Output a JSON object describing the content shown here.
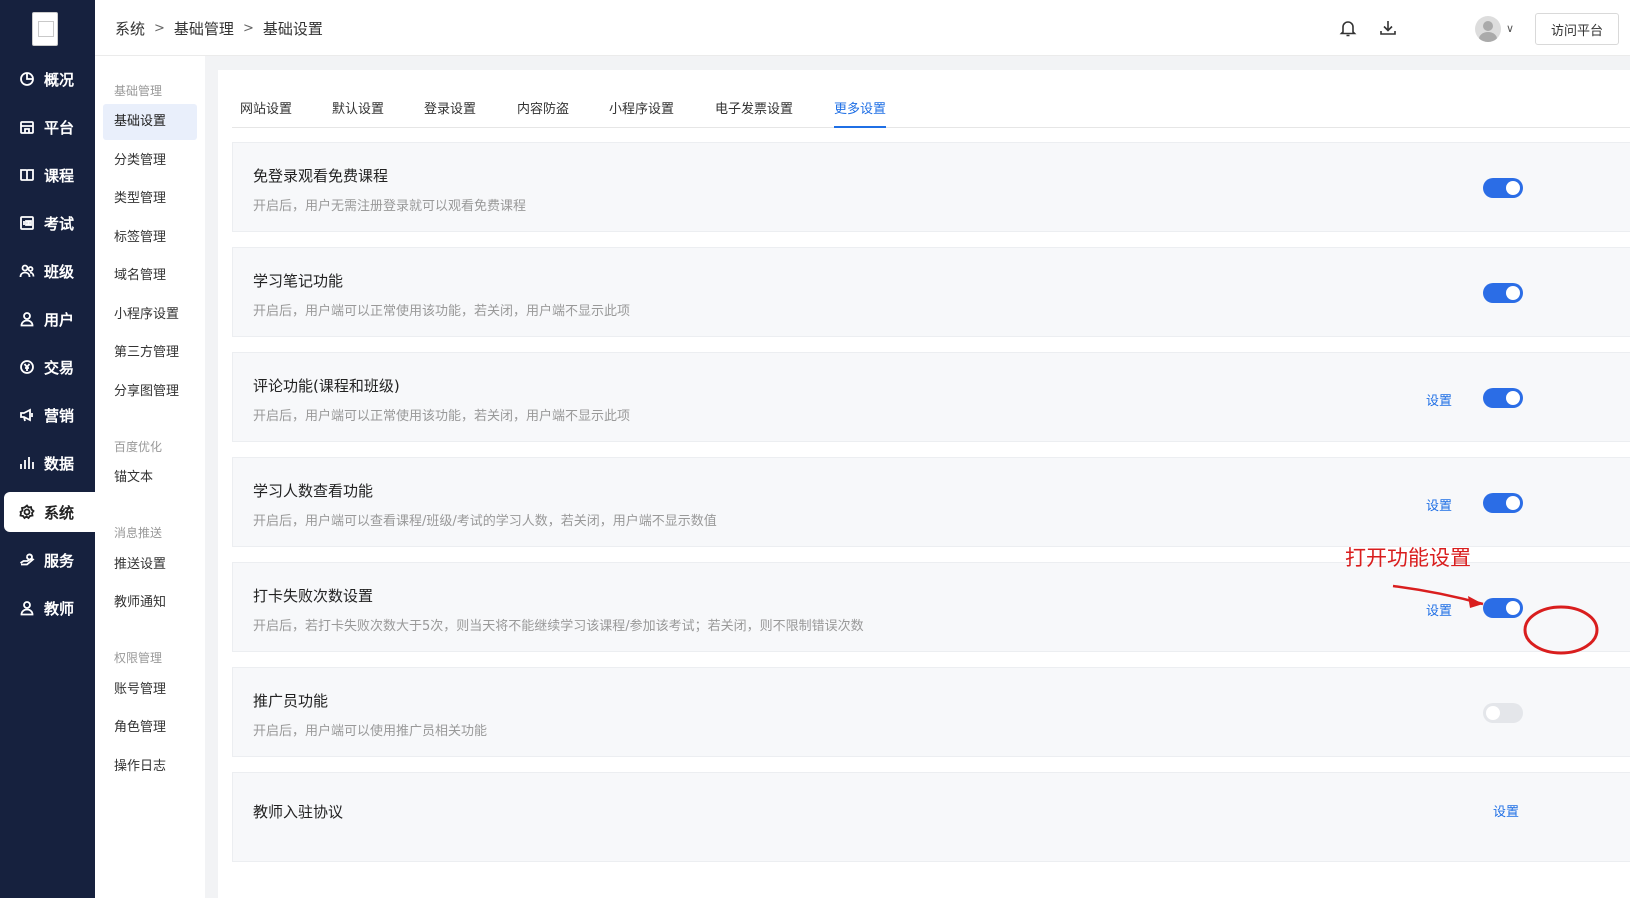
{
  "nav": {
    "items": [
      {
        "label": "概况",
        "icon": "pie-chart-icon"
      },
      {
        "label": "平台",
        "icon": "store-icon"
      },
      {
        "label": "课程",
        "icon": "book-icon"
      },
      {
        "label": "考试",
        "icon": "exam-100-icon"
      },
      {
        "label": "班级",
        "icon": "group-icon"
      },
      {
        "label": "用户",
        "icon": "user-icon"
      },
      {
        "label": "交易",
        "icon": "yen-icon"
      },
      {
        "label": "营销",
        "icon": "megaphone-icon"
      },
      {
        "label": "数据",
        "icon": "bar-chart-icon"
      },
      {
        "label": "系统",
        "icon": "gear-icon",
        "active": true
      },
      {
        "label": "服务",
        "icon": "service-hand-icon"
      },
      {
        "label": "教师",
        "icon": "teacher-icon"
      }
    ]
  },
  "submenu": {
    "groups": [
      {
        "label": "基础管理",
        "items": [
          "基础设置",
          "分类管理",
          "类型管理",
          "标签管理",
          "域名管理",
          "小程序设置",
          "第三方管理",
          "分享图管理"
        ]
      },
      {
        "label": "百度优化",
        "items": [
          "锚文本"
        ]
      },
      {
        "label": "消息推送",
        "items": [
          "推送设置",
          "教师通知"
        ]
      },
      {
        "label": "权限管理",
        "items": [
          "账号管理",
          "角色管理",
          "操作日志"
        ]
      }
    ],
    "active": "基础设置"
  },
  "header": {
    "breadcrumb": [
      "系统",
      "基础管理",
      "基础设置"
    ],
    "visit_button": "访问平台",
    "caret": "∨"
  },
  "tabs": [
    "网站设置",
    "默认设置",
    "登录设置",
    "内容防盗",
    "小程序设置",
    "电子发票设置",
    "更多设置"
  ],
  "active_tab": "更多设置",
  "settings": [
    {
      "title": "免登录观看免费课程",
      "desc": "开启后，用户无需注册登录就可以观看免费课程",
      "toggle": true,
      "has_link": false
    },
    {
      "title": "学习笔记功能",
      "desc": "开启后，用户端可以正常使用该功能，若关闭，用户端不显示此项",
      "toggle": true,
      "has_link": false
    },
    {
      "title": "评论功能(课程和班级)",
      "desc": "开启后，用户端可以正常使用该功能，若关闭，用户端不显示此项",
      "toggle": true,
      "has_link": true
    },
    {
      "title": "学习人数查看功能",
      "desc": "开启后，用户端可以查看课程/班级/考试的学习人数，若关闭，用户端不显示数值",
      "toggle": true,
      "has_link": true
    },
    {
      "title": "打卡失败次数设置",
      "desc": "开启后，若打卡失败次数大于5次，则当天将不能继续学习该课程/参加该考试；若关闭，则不限制错误次数",
      "toggle": true,
      "has_link": true
    },
    {
      "title": "推广员功能",
      "desc": "开启后，用户端可以使用推广员相关功能",
      "toggle": false,
      "has_link": false
    },
    {
      "title": "教师入驻协议",
      "desc": "",
      "toggle": null,
      "has_link": true
    }
  ],
  "set_link_label": "设置",
  "annotation": {
    "text": "打开功能设置",
    "color": "#d91e1e"
  },
  "colors": {
    "nav_bg": "#16213e",
    "accent": "#1f6fe5",
    "toggle_on": "#2b6de6"
  }
}
